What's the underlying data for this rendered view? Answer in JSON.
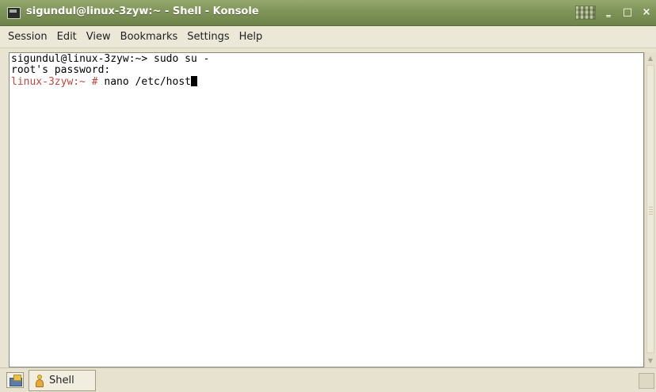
{
  "window": {
    "title": "sigundul@linux-3zyw:~ - Shell - Konsole",
    "buttons": {
      "minimize": "‗",
      "maximize": "□",
      "close": "×"
    }
  },
  "menubar": {
    "items": [
      "Session",
      "Edit",
      "View",
      "Bookmarks",
      "Settings",
      "Help"
    ]
  },
  "terminal": {
    "lines": [
      {
        "text": "sigundul@linux-3zyw:~> sudo su -"
      },
      {
        "text": "root's password:"
      },
      {
        "prompt": "linux-3zyw:~ #",
        "command": " nano /etc/host"
      }
    ]
  },
  "taskbar": {
    "task_label": "Shell"
  },
  "colors": {
    "titlebar": "#7f9459",
    "root_prompt": "#c2463c",
    "terminal_bg": "#ffffff"
  }
}
